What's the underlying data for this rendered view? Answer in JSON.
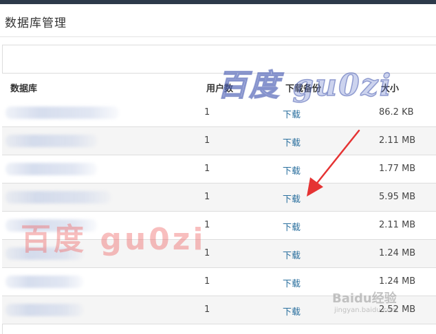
{
  "page": {
    "title": "数据库管理"
  },
  "table": {
    "headers": {
      "database": "数据库",
      "users": "用户数",
      "backup": "下载备份",
      "size": "大小"
    },
    "rows": [
      {
        "users": "1",
        "download": "下载",
        "size": "86.2 KB"
      },
      {
        "users": "1",
        "download": "下载",
        "size": "2.11 MB"
      },
      {
        "users": "1",
        "download": "下载",
        "size": "1.77 MB"
      },
      {
        "users": "1",
        "download": "下载",
        "size": "5.95 MB"
      },
      {
        "users": "1",
        "download": "下载",
        "size": "2.11 MB"
      },
      {
        "users": "1",
        "download": "下载",
        "size": "1.24 MB"
      },
      {
        "users": "1",
        "download": "下载",
        "size": "1.24 MB"
      },
      {
        "users": "1",
        "download": "下载",
        "size": "2.52 MB"
      }
    ]
  },
  "watermarks": {
    "top": "百度 gu0zi",
    "middle": "百度 gu0zi",
    "baidu_logo": "Baidu经验",
    "baidu_url": "jingyan.baidu.com"
  },
  "colors": {
    "link": "#2a6f9e",
    "arrow": "#e53333",
    "topbar": "#2d3a4a"
  }
}
